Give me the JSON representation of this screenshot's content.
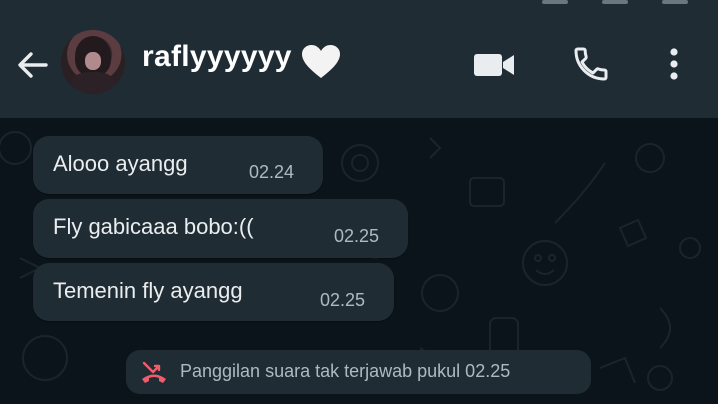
{
  "header": {
    "contact_name": "raflyyyyyy",
    "icons": {
      "back": "arrow-left-icon",
      "avatar": "profile-avatar",
      "heart": "white-heart-icon",
      "video": "video-camera-icon",
      "call": "phone-icon",
      "menu": "more-vertical-icon"
    }
  },
  "messages": [
    {
      "text": "Alooo ayangg",
      "time": "02.24"
    },
    {
      "text": "Fly gabicaaa bobo:((",
      "time": "02.25"
    },
    {
      "text": "Temenin fly ayangg",
      "time": "02.25"
    }
  ],
  "system_event": {
    "text": "Panggilan suara tak terjawab pukul 02.25",
    "icon": "missed-call-icon",
    "icon_color": "#f15c6d"
  },
  "colors": {
    "header_bg": "#1f2c33",
    "chat_bg": "#0b141a",
    "bubble_bg": "#202c33",
    "text": "#e9edef",
    "meta_text": "#aebac1"
  }
}
